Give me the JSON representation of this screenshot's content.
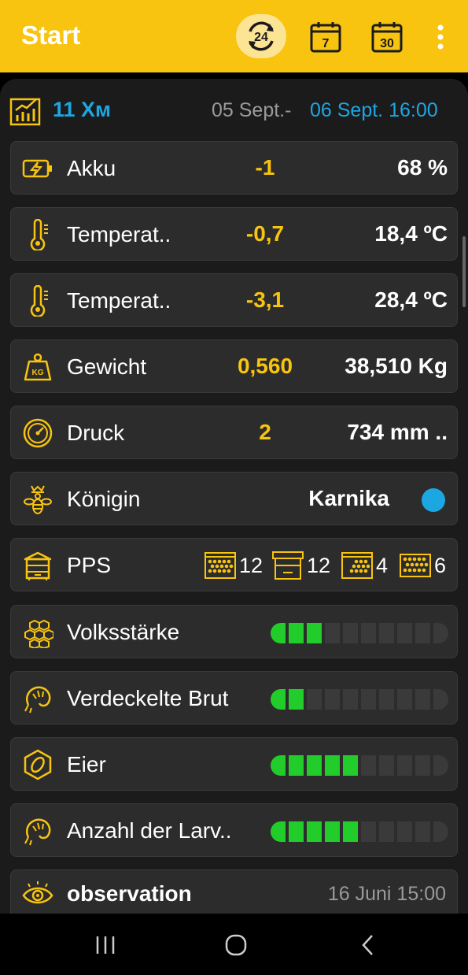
{
  "appbar": {
    "title": "Start",
    "icons": [
      "rotate-24h-icon",
      "calendar-7-icon",
      "calendar-30-icon",
      "more-vert-icon"
    ],
    "label_24": "24",
    "label_7": "7",
    "label_30": "30",
    "color": "#F8C40F"
  },
  "summary": {
    "icon": "chart-icon",
    "period": "11 Хм",
    "from": "05 Sept.-",
    "to": "06 Sept. 16:00"
  },
  "sensors": [
    {
      "icon": "battery-charging-icon",
      "label": "Akku",
      "delta": "-1",
      "value": "68 %"
    },
    {
      "icon": "thermometer-icon",
      "label": "Temperat..",
      "delta": "-0,7",
      "value": "18,4 ºC"
    },
    {
      "icon": "thermometer-icon",
      "label": "Temperat..",
      "delta": "-3,1",
      "value": "28,4 ºC"
    },
    {
      "icon": "weight-kg-icon",
      "label": "Gewicht",
      "delta": "0,560",
      "value": "38,510 Kg"
    },
    {
      "icon": "gauge-icon",
      "label": "Druck",
      "delta": "2",
      "value": "734 mm .."
    }
  ],
  "queen": {
    "icon": "queen-bee-icon",
    "label": "Königin",
    "value": "Karnika",
    "dot_color": "#1DA7E2"
  },
  "pps": {
    "icon": "beehive-icon",
    "label": "PPS",
    "items": [
      {
        "icon": "frame-comb-icon",
        "count": "12"
      },
      {
        "icon": "hive-box-icon",
        "count": "12"
      },
      {
        "icon": "frame-half-icon",
        "count": "4"
      },
      {
        "icon": "honeycomb-cells-icon",
        "count": "6"
      }
    ]
  },
  "ratings": [
    {
      "icon": "honeycomb-icon",
      "label": "Volksstärke",
      "level": 3,
      "max": 10
    },
    {
      "icon": "larva-icon",
      "label": "Verdeckelte Brut",
      "level": 2,
      "max": 10
    },
    {
      "icon": "egg-icon",
      "label": "Eier",
      "level": 5,
      "max": 10
    },
    {
      "icon": "larva-icon",
      "label": "Anzahl der Larv..",
      "level": 5,
      "max": 10
    }
  ],
  "observation": {
    "icon": "eye-icon",
    "title": "observation",
    "date": "16 Juni 15:00"
  },
  "navbar": {
    "icons": [
      "recent-apps-icon",
      "home-icon",
      "back-icon"
    ]
  }
}
